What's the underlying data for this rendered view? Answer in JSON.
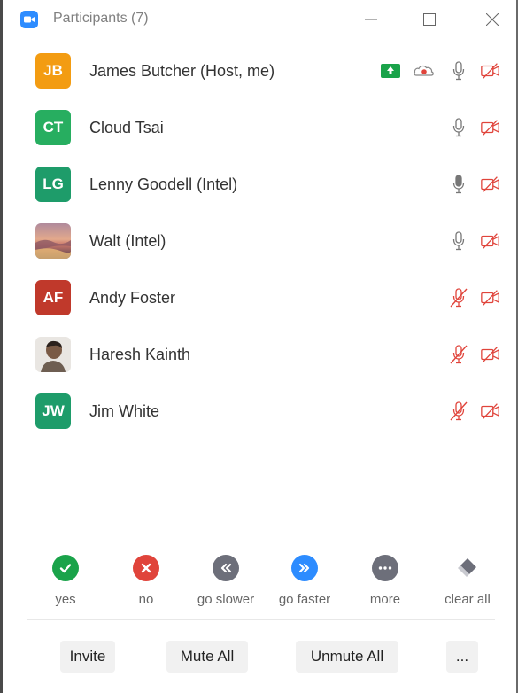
{
  "window": {
    "title": "Participants (7)",
    "accent": "#2d8cff"
  },
  "participants": [
    {
      "initials": "JB",
      "name": "James Butcher (Host, me)",
      "avatar_color": "#f39c12",
      "share": true,
      "record": true,
      "mic": "on",
      "video": "off"
    },
    {
      "initials": "CT",
      "name": "Cloud Tsai",
      "avatar_color": "#27ae60",
      "mic": "on",
      "video": "off"
    },
    {
      "initials": "LG",
      "name": "Lenny Goodell (Intel)",
      "avatar_color": "#1e9c6a",
      "mic": "speaking",
      "video": "off"
    },
    {
      "initials": "",
      "name": "Walt (Intel)",
      "avatar_type": "photo-sunset",
      "mic": "on",
      "video": "off"
    },
    {
      "initials": "AF",
      "name": "Andy Foster",
      "avatar_color": "#c0392b",
      "mic": "muted",
      "video": "off"
    },
    {
      "initials": "",
      "name": "Haresh Kainth",
      "avatar_type": "photo-person",
      "mic": "muted",
      "video": "off"
    },
    {
      "initials": "JW",
      "name": "Jim White",
      "avatar_color": "#1e9c6a",
      "mic": "muted",
      "video": "off"
    }
  ],
  "reactions": [
    {
      "label": "yes",
      "icon": "check-icon",
      "color": "#1aa34a"
    },
    {
      "label": "no",
      "icon": "x-icon",
      "color": "#e0443b"
    },
    {
      "label": "go slower",
      "icon": "rewind-icon",
      "color": "#6d6f7a"
    },
    {
      "label": "go faster",
      "icon": "fast-forward-icon",
      "color": "#2d8cff"
    },
    {
      "label": "more",
      "icon": "more-icon",
      "color": "#6d6f7a"
    },
    {
      "label": "clear all",
      "icon": "eraser-icon",
      "color": "#6d6f7a"
    }
  ],
  "buttons": {
    "invite": "Invite",
    "mute_all": "Mute All",
    "unmute_all": "Unmute All",
    "more": "..."
  }
}
